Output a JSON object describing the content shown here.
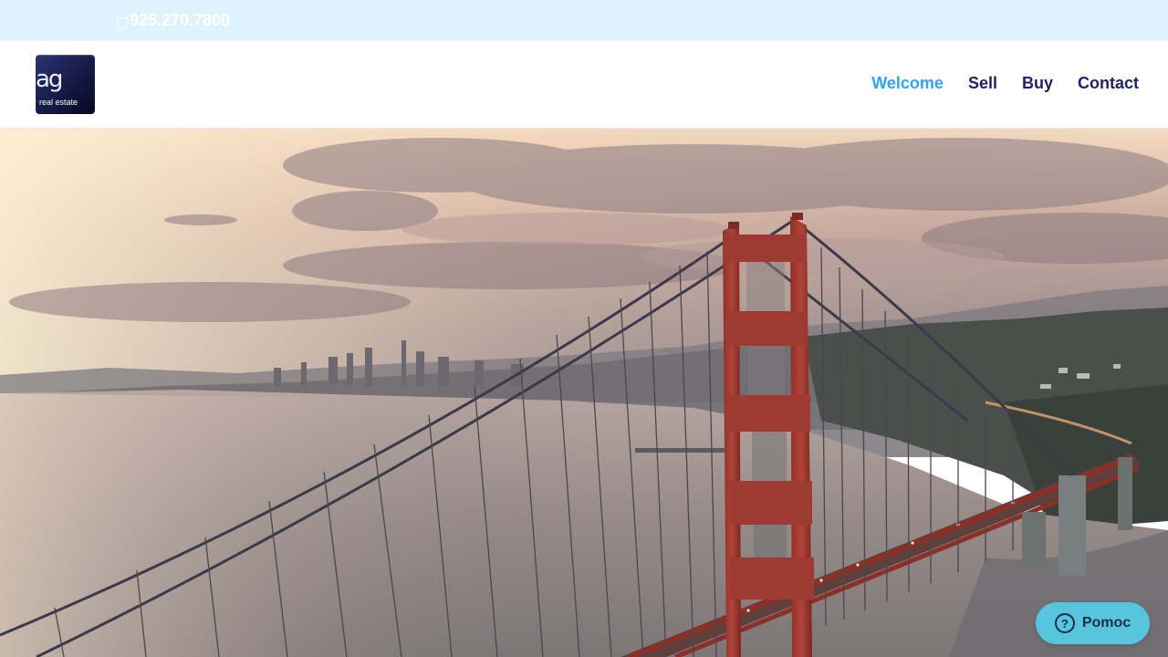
{
  "topbar": {
    "phone_icon": "phone-icon",
    "phone": "925.270.7800"
  },
  "header": {
    "logo": {
      "mark": "ag",
      "subtitle": "real estate"
    },
    "nav": [
      {
        "label": "Welcome",
        "active": true
      },
      {
        "label": "Sell",
        "active": false
      },
      {
        "label": "Buy",
        "active": false
      },
      {
        "label": "Contact",
        "active": false
      }
    ]
  },
  "hero": {
    "image": "golden-gate-bridge-aerial"
  },
  "help": {
    "icon": "question-circle-icon",
    "label": "Pomoc"
  },
  "colors": {
    "topbar_bg": "#def3fd",
    "nav_active": "#2ea3f2",
    "nav_default": "#1f2363",
    "help_bg": "#56c5dd",
    "bridge": "#a5382f"
  }
}
